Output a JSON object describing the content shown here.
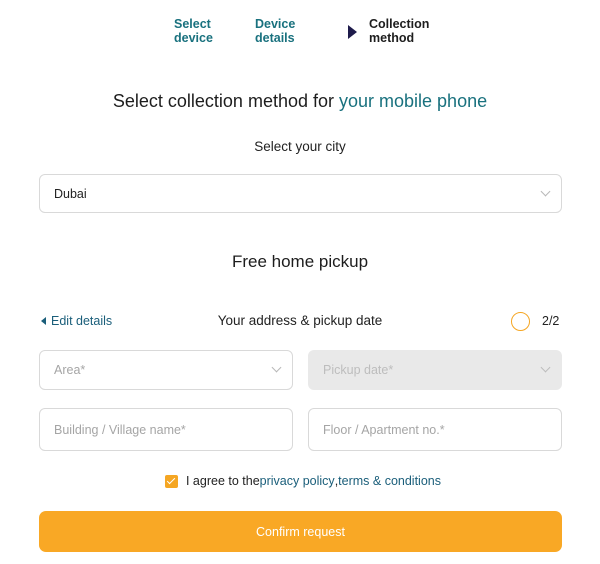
{
  "stepper": {
    "steps": [
      {
        "line1": "Select",
        "line2": "device"
      },
      {
        "line1": "Device",
        "line2": "details"
      },
      {
        "line1": "Collection",
        "line2": "method"
      }
    ]
  },
  "title": {
    "prefix": "Select collection method for ",
    "accent": "your mobile phone"
  },
  "city": {
    "label": "Select your city",
    "value": "Dubai"
  },
  "pickup": {
    "title": "Free home pickup",
    "edit_link": "Edit details",
    "section_label": "Your address & pickup date",
    "progress": "2/2"
  },
  "form": {
    "area_placeholder": "Area*",
    "pickup_date_placeholder": "Pickup date*",
    "building_placeholder": "Building / Village name*",
    "floor_placeholder": "Floor / Apartment no.*"
  },
  "agreement": {
    "text": "I agree to the ",
    "privacy_link": "privacy policy",
    "separator": ", ",
    "terms_link": "terms & conditions"
  },
  "confirm_label": "Confirm request",
  "colors": {
    "accent": "#19717e",
    "link": "#1a5e7a",
    "primary_button": "#f9a825",
    "checkbox": "#f5a623"
  },
  "icons": [
    "chevron-down-icon",
    "chevron-left-icon",
    "current-step-arrow-icon",
    "progress-ring-icon",
    "checkmark-icon"
  ]
}
